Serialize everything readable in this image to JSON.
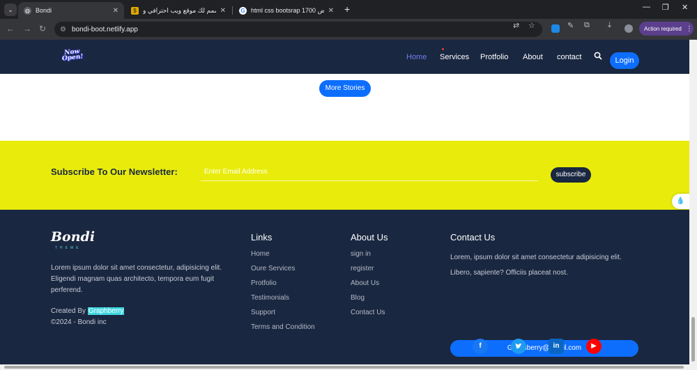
{
  "browser": {
    "tabs": [
      {
        "title": "Bondi",
        "active": true
      },
      {
        "title": "سأصمم لك موقع ويب احترافي و...",
        "active": false
      },
      {
        "title": "html css bootsrap 1700 عرض...",
        "active": false
      }
    ],
    "url": "bondi-boot.netlify.app",
    "action_required": "Action required"
  },
  "nav": {
    "logo_text": "Now Open!",
    "links": [
      "Home",
      "Services",
      "Protfolio",
      "About",
      "contact"
    ],
    "login": "Login"
  },
  "stories": {
    "more_label": "More Stories"
  },
  "newsletter": {
    "title": "Subscribe To Our Newsletter:",
    "placeholder": "Enter Email Address",
    "button": "subscribe"
  },
  "footer": {
    "brand": "Bondi",
    "brand_sub": "THEME",
    "about_text": "Lorem ipsum dolor sit amet consectetur, adipisicing elit. Eligendi magnam quas architecto, tempora eum fugit perferend.",
    "created_by": "Created By",
    "created_link": "Graphberry",
    "copyright": "©2024 - Bondi inc",
    "links_title": "Links",
    "links": [
      "Home",
      "Oure Services",
      "Protfolio",
      "Testimonials",
      "Support",
      "Terms and Condition"
    ],
    "about_title": "About Us",
    "about_links": [
      "sign in",
      "register",
      "About Us",
      "Blog",
      "Contact Us"
    ],
    "contact_title": "Contact Us",
    "contact_text": "Lorem, ipsum dolor sit amet consectetur adipisicing elit. Libero, sapiente? Officiis placeat nost.",
    "email": "Graphberry@gmail.com",
    "socials": [
      "facebook",
      "twitter",
      "linkedin",
      "youtube"
    ]
  },
  "colors": {
    "navy": "#1a2740",
    "yellow": "#e9ec0a",
    "primary": "#0d6efd",
    "highlight": "#3fd6e0"
  }
}
